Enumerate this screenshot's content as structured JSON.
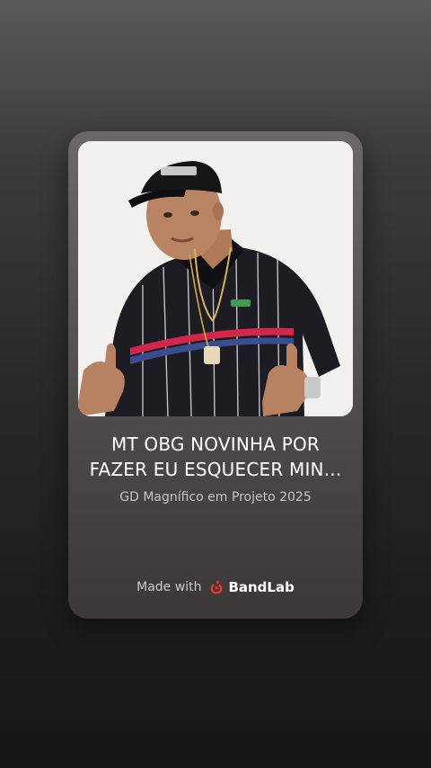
{
  "track": {
    "title_line1": "MT OBG NOVINHA POR",
    "title_line2": "FAZER EU ESQUECER MIN...",
    "subtitle": "GD Magnífico em Projeto 2025"
  },
  "footer": {
    "made_with_label": "Made with",
    "brand_name": "BandLab"
  },
  "colors": {
    "brand_red": "#f0342b",
    "card_top": "#6e6767",
    "background_bottom": "#151515"
  },
  "icons": {
    "brand_logo": "bandlab-logo-icon"
  }
}
